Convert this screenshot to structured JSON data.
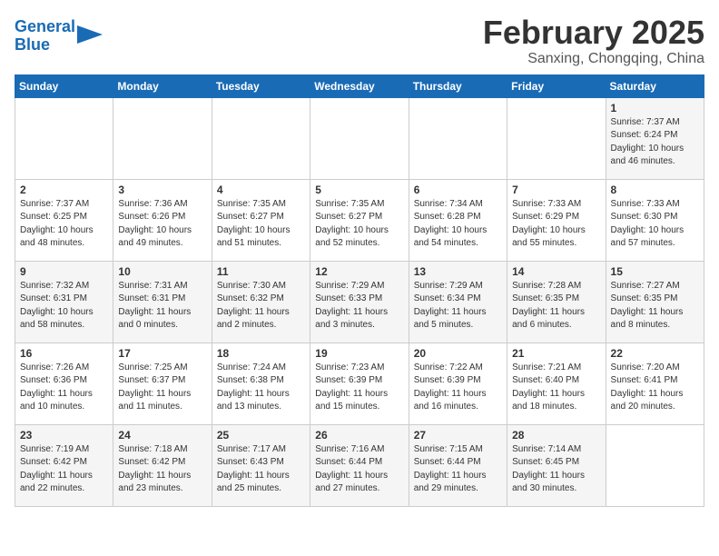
{
  "app": {
    "name": "GeneralBlue",
    "logo_arrow": "▶"
  },
  "calendar": {
    "month_year": "February 2025",
    "location": "Sanxing, Chongqing, China"
  },
  "weekdays": [
    "Sunday",
    "Monday",
    "Tuesday",
    "Wednesday",
    "Thursday",
    "Friday",
    "Saturday"
  ],
  "weeks": [
    [
      {
        "day": "",
        "info": ""
      },
      {
        "day": "",
        "info": ""
      },
      {
        "day": "",
        "info": ""
      },
      {
        "day": "",
        "info": ""
      },
      {
        "day": "",
        "info": ""
      },
      {
        "day": "",
        "info": ""
      },
      {
        "day": "1",
        "info": "Sunrise: 7:37 AM\nSunset: 6:24 PM\nDaylight: 10 hours and 46 minutes."
      }
    ],
    [
      {
        "day": "2",
        "info": "Sunrise: 7:37 AM\nSunset: 6:25 PM\nDaylight: 10 hours and 48 minutes."
      },
      {
        "day": "3",
        "info": "Sunrise: 7:36 AM\nSunset: 6:26 PM\nDaylight: 10 hours and 49 minutes."
      },
      {
        "day": "4",
        "info": "Sunrise: 7:35 AM\nSunset: 6:27 PM\nDaylight: 10 hours and 51 minutes."
      },
      {
        "day": "5",
        "info": "Sunrise: 7:35 AM\nSunset: 6:27 PM\nDaylight: 10 hours and 52 minutes."
      },
      {
        "day": "6",
        "info": "Sunrise: 7:34 AM\nSunset: 6:28 PM\nDaylight: 10 hours and 54 minutes."
      },
      {
        "day": "7",
        "info": "Sunrise: 7:33 AM\nSunset: 6:29 PM\nDaylight: 10 hours and 55 minutes."
      },
      {
        "day": "8",
        "info": "Sunrise: 7:33 AM\nSunset: 6:30 PM\nDaylight: 10 hours and 57 minutes."
      }
    ],
    [
      {
        "day": "9",
        "info": "Sunrise: 7:32 AM\nSunset: 6:31 PM\nDaylight: 10 hours and 58 minutes."
      },
      {
        "day": "10",
        "info": "Sunrise: 7:31 AM\nSunset: 6:31 PM\nDaylight: 11 hours and 0 minutes."
      },
      {
        "day": "11",
        "info": "Sunrise: 7:30 AM\nSunset: 6:32 PM\nDaylight: 11 hours and 2 minutes."
      },
      {
        "day": "12",
        "info": "Sunrise: 7:29 AM\nSunset: 6:33 PM\nDaylight: 11 hours and 3 minutes."
      },
      {
        "day": "13",
        "info": "Sunrise: 7:29 AM\nSunset: 6:34 PM\nDaylight: 11 hours and 5 minutes."
      },
      {
        "day": "14",
        "info": "Sunrise: 7:28 AM\nSunset: 6:35 PM\nDaylight: 11 hours and 6 minutes."
      },
      {
        "day": "15",
        "info": "Sunrise: 7:27 AM\nSunset: 6:35 PM\nDaylight: 11 hours and 8 minutes."
      }
    ],
    [
      {
        "day": "16",
        "info": "Sunrise: 7:26 AM\nSunset: 6:36 PM\nDaylight: 11 hours and 10 minutes."
      },
      {
        "day": "17",
        "info": "Sunrise: 7:25 AM\nSunset: 6:37 PM\nDaylight: 11 hours and 11 minutes."
      },
      {
        "day": "18",
        "info": "Sunrise: 7:24 AM\nSunset: 6:38 PM\nDaylight: 11 hours and 13 minutes."
      },
      {
        "day": "19",
        "info": "Sunrise: 7:23 AM\nSunset: 6:39 PM\nDaylight: 11 hours and 15 minutes."
      },
      {
        "day": "20",
        "info": "Sunrise: 7:22 AM\nSunset: 6:39 PM\nDaylight: 11 hours and 16 minutes."
      },
      {
        "day": "21",
        "info": "Sunrise: 7:21 AM\nSunset: 6:40 PM\nDaylight: 11 hours and 18 minutes."
      },
      {
        "day": "22",
        "info": "Sunrise: 7:20 AM\nSunset: 6:41 PM\nDaylight: 11 hours and 20 minutes."
      }
    ],
    [
      {
        "day": "23",
        "info": "Sunrise: 7:19 AM\nSunset: 6:42 PM\nDaylight: 11 hours and 22 minutes."
      },
      {
        "day": "24",
        "info": "Sunrise: 7:18 AM\nSunset: 6:42 PM\nDaylight: 11 hours and 23 minutes."
      },
      {
        "day": "25",
        "info": "Sunrise: 7:17 AM\nSunset: 6:43 PM\nDaylight: 11 hours and 25 minutes."
      },
      {
        "day": "26",
        "info": "Sunrise: 7:16 AM\nSunset: 6:44 PM\nDaylight: 11 hours and 27 minutes."
      },
      {
        "day": "27",
        "info": "Sunrise: 7:15 AM\nSunset: 6:44 PM\nDaylight: 11 hours and 29 minutes."
      },
      {
        "day": "28",
        "info": "Sunrise: 7:14 AM\nSunset: 6:45 PM\nDaylight: 11 hours and 30 minutes."
      },
      {
        "day": "",
        "info": ""
      }
    ]
  ]
}
